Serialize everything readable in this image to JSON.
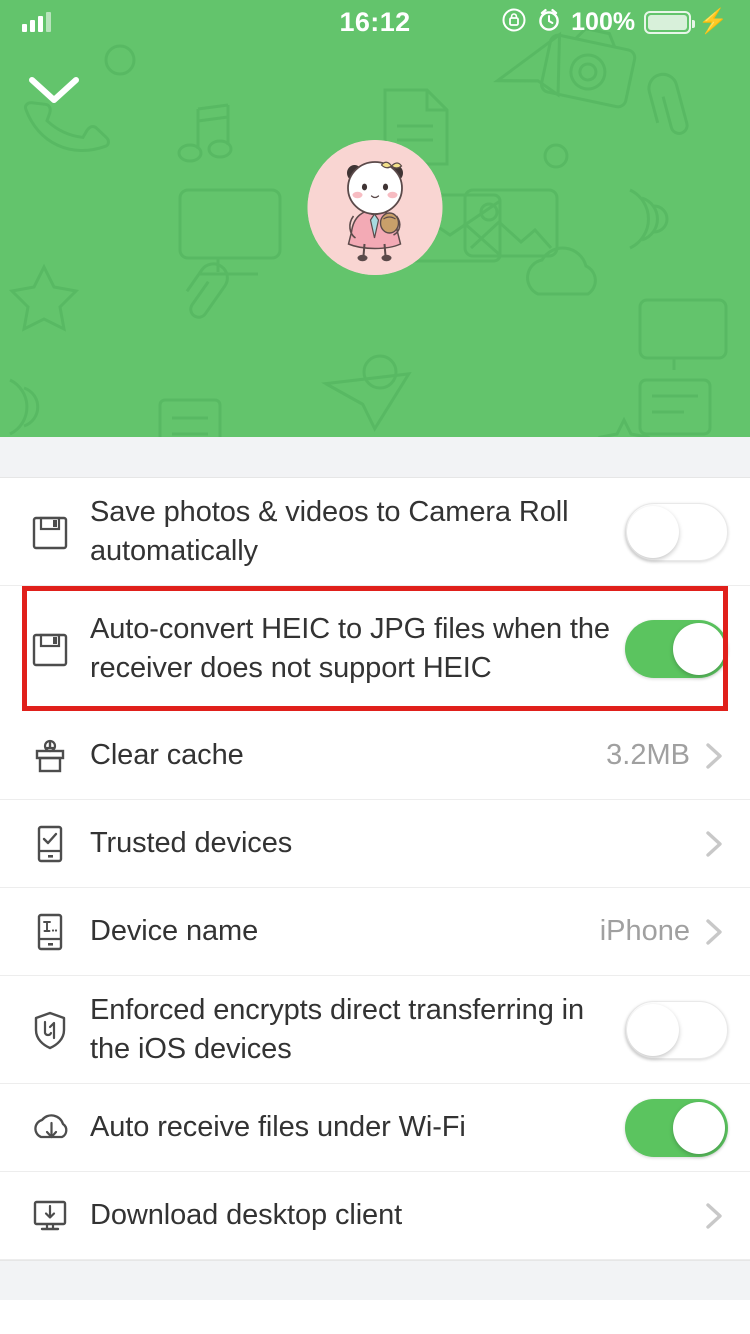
{
  "status_bar": {
    "time": "16:12",
    "battery_percent": "100%",
    "icons": [
      "signal-bars-icon",
      "rotation-lock-icon",
      "alarm-clock-icon",
      "battery-icon",
      "charging-bolt-icon"
    ]
  },
  "header": {
    "background_color": "#63c46c",
    "back_button": "chevron-down-icon",
    "avatar": {
      "name": "panda-avatar",
      "background_color": "#f9d5d2"
    },
    "decorative_icons": [
      "phone-outline-icon",
      "music-note-icon",
      "camera-icon",
      "monitor-icon",
      "envelope-icon",
      "star-icon",
      "paperclip-icon",
      "document-icon",
      "paper-plane-icon",
      "cloud-icon",
      "image-icon",
      "circle-icon"
    ]
  },
  "settings": {
    "rows": [
      {
        "id": "save-photos-videos",
        "icon": "floppy-disk-icon",
        "label": "Save photos & videos to Camera Roll automatically",
        "control": "toggle",
        "toggle_state": "off",
        "value": "",
        "highlighted": false
      },
      {
        "id": "auto-convert-heic",
        "icon": "floppy-disk-icon",
        "label": "Auto-convert HEIC to JPG files when the receiver does not support HEIC",
        "control": "toggle",
        "toggle_state": "on",
        "value": "",
        "highlighted": true
      },
      {
        "id": "clear-cache",
        "icon": "broom-icon",
        "label": "Clear cache",
        "control": "chevron",
        "toggle_state": "",
        "value": "3.2MB",
        "highlighted": false
      },
      {
        "id": "trusted-devices",
        "icon": "phone-check-icon",
        "label": "Trusted devices",
        "control": "chevron",
        "toggle_state": "",
        "value": "",
        "highlighted": false
      },
      {
        "id": "device-name",
        "icon": "phone-text-icon",
        "label": "Device name",
        "control": "chevron",
        "toggle_state": "",
        "value": "iPhone",
        "highlighted": false
      },
      {
        "id": "enforced-encryption",
        "icon": "shield-icon",
        "label": "Enforced encrypts direct transferring in the iOS devices",
        "control": "toggle",
        "toggle_state": "off",
        "value": "",
        "highlighted": false
      },
      {
        "id": "auto-receive-wifi",
        "icon": "cloud-download-icon",
        "label": "Auto receive files under Wi-Fi",
        "control": "toggle",
        "toggle_state": "on",
        "value": "",
        "highlighted": false
      },
      {
        "id": "download-desktop-client",
        "icon": "monitor-download-icon",
        "label": "Download desktop client",
        "control": "chevron",
        "toggle_state": "",
        "value": "",
        "highlighted": false
      }
    ]
  },
  "colors": {
    "accent_green": "#63c46c",
    "toggle_on_green": "#5bc45f",
    "highlight_red": "#e0201b",
    "value_grey": "#a0a0a0"
  }
}
